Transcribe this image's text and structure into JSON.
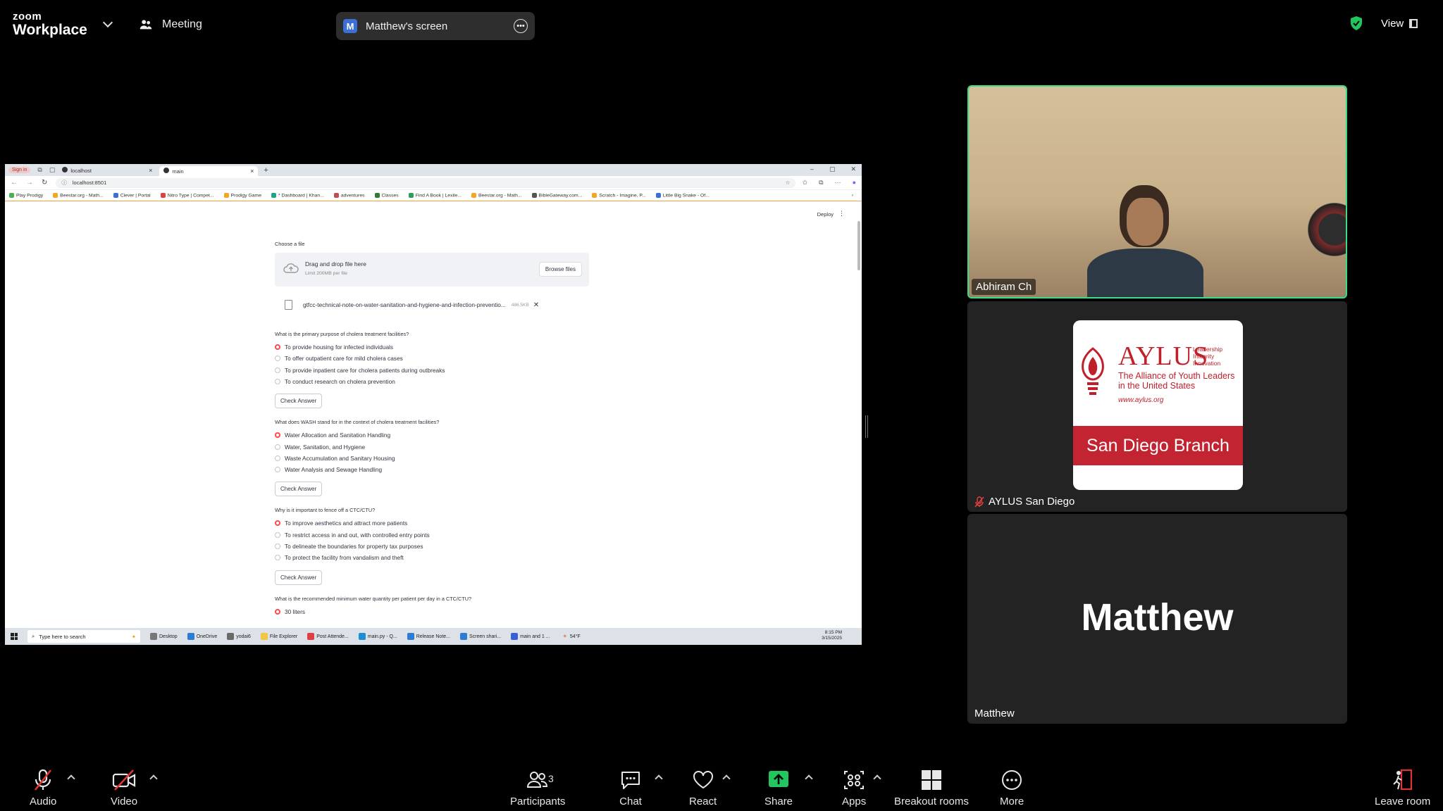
{
  "topbar": {
    "brand_small": "zoom",
    "brand_large": "Workplace",
    "meeting_label": "Meeting",
    "screen_badge": "M",
    "screen_label": "Matthew's screen",
    "view_label": "View"
  },
  "browser": {
    "signin": "Sign in",
    "tabs": [
      {
        "label": "localhost"
      },
      {
        "label": "main"
      }
    ],
    "url": "localhost:8501",
    "bookmarks": [
      "Play Prodigy",
      "Beestar.org - Math...",
      "Clever | Portal",
      "Nitro Type | Compet...",
      "Prodigy Game",
      "* Dashboard | Khan...",
      "adventures",
      "Classes",
      "Find A Book | Lexile...",
      "Beestar.org - Math...",
      "BibleGateway.com...",
      "Scratch - Imagine, P...",
      "Little Big Snake - Of..."
    ]
  },
  "app": {
    "deploy": "Deploy",
    "choose_file": "Choose a file",
    "drag_drop": "Drag and drop file here",
    "limit": "Limit 200MB per file",
    "browse": "Browse files",
    "file_name": "gtfcc-technical-note-on-water-sanitation-and-hygiene-and-infection-preventio...",
    "file_size": "486.5KB",
    "check_answer": "Check Answer",
    "questions": [
      {
        "q": "What is the primary purpose of cholera treatment facilities?",
        "options": [
          "To provide housing for infected individuals",
          "To offer outpatient care for mild cholera cases",
          "To provide inpatient care for cholera patients during outbreaks",
          "To conduct research on cholera prevention"
        ],
        "selected": 0
      },
      {
        "q": "What does WASH stand for in the context of cholera treatment facilities?",
        "options": [
          "Water Allocation and Sanitation Handling",
          "Water, Sanitation, and Hygiene",
          "Waste Accumulation and Sanitary Housing",
          "Water Analysis and Sewage Handling"
        ],
        "selected": 0
      },
      {
        "q": "Why is it important to fence off a CTC/CTU?",
        "options": [
          "To improve aesthetics and attract more patients",
          "To restrict access in and out, with controlled entry points",
          "To delineate the boundaries for property tax purposes",
          "To protect the facility from vandalism and theft"
        ],
        "selected": 0
      },
      {
        "q": "What is the recommended minimum water quantity per patient per day in a CTC/CTU?",
        "options": [
          "30 liters"
        ],
        "selected": 0
      }
    ]
  },
  "taskbar": {
    "search": "Type here to search",
    "items": [
      "Desktop",
      "OneDrive",
      "yodai6",
      "File Explorer",
      "Post Attende...",
      "main.py - Q...",
      "Release Note...",
      "Screen shari...",
      "main and 1 ..."
    ],
    "weather": "54°F",
    "time": "8:15 PM",
    "date": "3/15/2025"
  },
  "participants": {
    "tile1_name": "Abhiram Ch",
    "tile2_name": "AYLUS San Diego",
    "tile3_big": "Matthew",
    "tile3_name": "Matthew",
    "aylus": {
      "word": "AYLUS",
      "tagline_1": "Leadership",
      "tagline_2": "Integrity",
      "tagline_3": "Innovation",
      "sub_1": "The Alliance of Youth Leaders",
      "sub_2": "in the United States",
      "url": "www.aylus.org",
      "band": "San Diego Branch"
    }
  },
  "toolbar": {
    "audio": "Audio",
    "video": "Video",
    "participants_count": "3",
    "participants": "Participants",
    "chat": "Chat",
    "react": "React",
    "share": "Share",
    "apps": "Apps",
    "breakout": "Breakout rooms",
    "more": "More",
    "leave": "Leave room"
  },
  "colors": {
    "accent_green": "#3ddc84",
    "share_green": "#22c55e",
    "radio_red": "#ff4b4b",
    "aylus_red": "#c22432"
  }
}
